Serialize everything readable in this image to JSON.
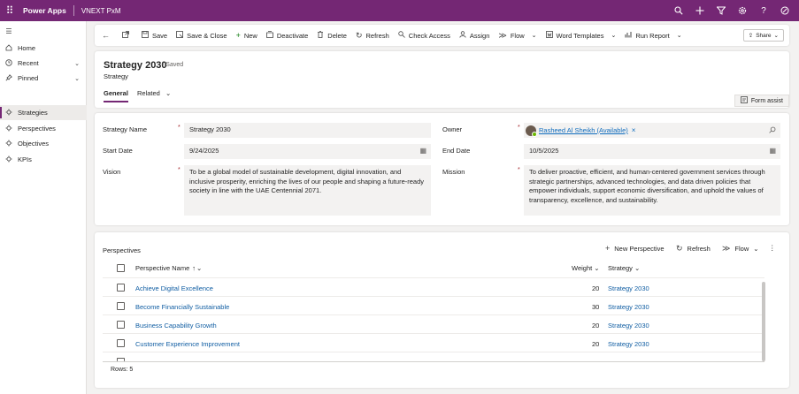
{
  "topbar": {
    "app_name": "Power Apps",
    "environment": "VNEXT PxM",
    "icons": [
      "waffle-icon",
      "search-icon",
      "add-icon",
      "filter-icon",
      "settings-icon",
      "help-icon",
      "copilot-icon"
    ]
  },
  "sidebar": {
    "items": [
      {
        "label": "Home",
        "icon": "home-icon"
      },
      {
        "label": "Recent",
        "icon": "clock-icon"
      },
      {
        "label": "Pinned",
        "icon": "pin-icon"
      },
      {
        "label": "Strategies",
        "icon": "entity-icon",
        "active": true
      },
      {
        "label": "Perspectives",
        "icon": "entity-icon"
      },
      {
        "label": "Objectives",
        "icon": "entity-icon"
      },
      {
        "label": "KPIs",
        "icon": "entity-icon"
      }
    ]
  },
  "command_bar": {
    "save": "Save",
    "save_close": "Save & Close",
    "new": "New",
    "deactivate": "Deactivate",
    "delete": "Delete",
    "refresh": "Refresh",
    "check_access": "Check Access",
    "assign": "Assign",
    "flow": "Flow",
    "word_templates": "Word Templates",
    "run_report": "Run Report",
    "share": "Share"
  },
  "record": {
    "title": "Strategy 2030",
    "saved_status": "- Saved",
    "entity": "Strategy",
    "tabs": [
      "General",
      "Related"
    ],
    "form_assist": "Form assist"
  },
  "form": {
    "strategy_name_label": "Strategy Name",
    "strategy_name": "Strategy 2030",
    "start_date_label": "Start Date",
    "start_date": "9/24/2025",
    "vision_label": "Vision",
    "vision": "To be a global model of sustainable development, digital innovation, and inclusive prosperity, enriching the lives of our people and shaping a future-ready society in line with the UAE Centennial 2071.",
    "owner_label": "Owner",
    "owner": "Rasheed Al Sheikh (Available)",
    "end_date_label": "End Date",
    "end_date": "10/5/2025",
    "mission_label": "Mission",
    "mission": "To deliver proactive, efficient, and human-centered government services through strategic partnerships, advanced technologies, and data driven policies that empower individuals, support economic diversification, and uphold the values of transparency, excellence, and sustainability.",
    "required_mark": "*"
  },
  "perspectives": {
    "title": "Perspectives",
    "new_label": "New Perspective",
    "refresh_label": "Refresh",
    "flow_label": "Flow",
    "columns": {
      "name": "Perspective Name",
      "weight": "Weight",
      "strategy": "Strategy"
    },
    "rows": [
      {
        "name": "Achieve Digital Excellence",
        "weight": "20",
        "strategy": "Strategy 2030"
      },
      {
        "name": "Become Financially Sustainable",
        "weight": "30",
        "strategy": "Strategy 2030"
      },
      {
        "name": "Business Capability Growth",
        "weight": "20",
        "strategy": "Strategy 2030"
      },
      {
        "name": "Customer Experience Improvement",
        "weight": "20",
        "strategy": "Strategy 2030"
      }
    ],
    "rows_count": "Rows: 5"
  }
}
